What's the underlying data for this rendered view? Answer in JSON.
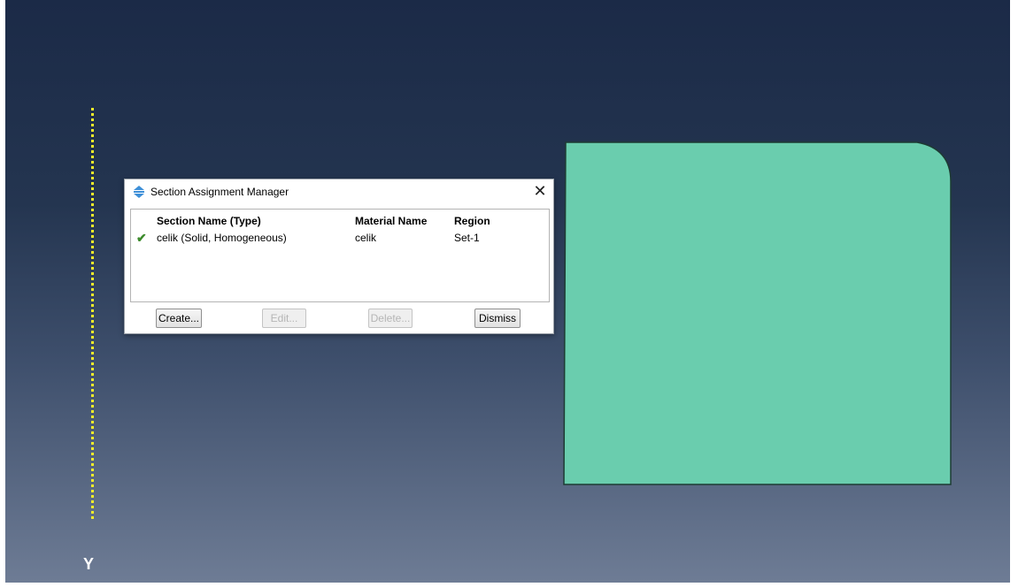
{
  "viewport": {
    "axis_label": "Y",
    "part_color": "#6acdae",
    "axis_color": "#f2ee2a"
  },
  "dialog": {
    "title": "Section Assignment Manager",
    "title_icon": "section-assignment-icon",
    "close_glyph": "✕",
    "columns": [
      "Section Name (Type)",
      "Material Name",
      "Region"
    ],
    "rows": [
      {
        "status_icon": "check-icon",
        "status_glyph": "✔",
        "section": "celik (Solid, Homogeneous)",
        "material": "celik",
        "region": "Set-1"
      }
    ],
    "buttons": {
      "create": "Create...",
      "edit": "Edit...",
      "delete": "Delete...",
      "dismiss": "Dismiss"
    }
  }
}
